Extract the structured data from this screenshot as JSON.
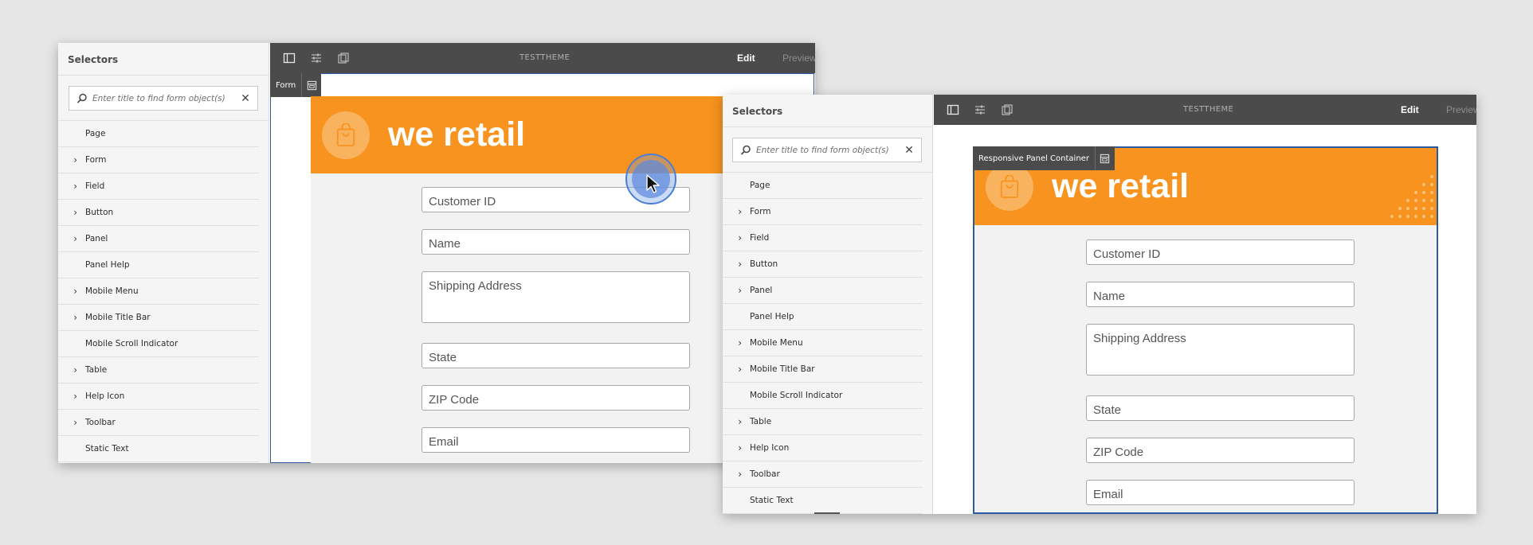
{
  "selectors_title": "Selectors",
  "search_placeholder": "Enter title to find form object(s)",
  "selector_items": [
    {
      "label": "Page",
      "chevron": false
    },
    {
      "label": "Form",
      "chevron": true
    },
    {
      "label": "Field",
      "chevron": true
    },
    {
      "label": "Button",
      "chevron": true
    },
    {
      "label": "Panel",
      "chevron": true
    },
    {
      "label": "Panel Help",
      "chevron": false
    },
    {
      "label": "Mobile Menu",
      "chevron": true
    },
    {
      "label": "Mobile Title Bar",
      "chevron": true
    },
    {
      "label": "Mobile Scroll Indicator",
      "chevron": false
    },
    {
      "label": "Table",
      "chevron": true
    },
    {
      "label": "Help Icon",
      "chevron": true
    },
    {
      "label": "Toolbar",
      "chevron": true
    },
    {
      "label": "Static Text",
      "chevron": false
    }
  ],
  "theme_name": "TESTTHEME",
  "edit_label": "Edit",
  "preview_label": "Preview",
  "brand_text": "we retail",
  "form_fields": [
    "Customer ID",
    "Name",
    "Shipping Address",
    "State",
    "ZIP Code",
    "Email"
  ],
  "window1": {
    "selected_tag": "Form"
  },
  "window2": {
    "selected_tag": "Responsive Panel Container"
  },
  "colors": {
    "accent": "#f7931e",
    "toolbar": "#4b4b4b",
    "selection": "#2c5aa0"
  },
  "icons": [
    "search-icon",
    "close-icon",
    "chevron-right-icon",
    "sidebar-toggle-icon",
    "properties-icon",
    "layers-icon",
    "panel-container-icon",
    "shopping-bag-icon",
    "pointer-cursor-icon"
  ]
}
